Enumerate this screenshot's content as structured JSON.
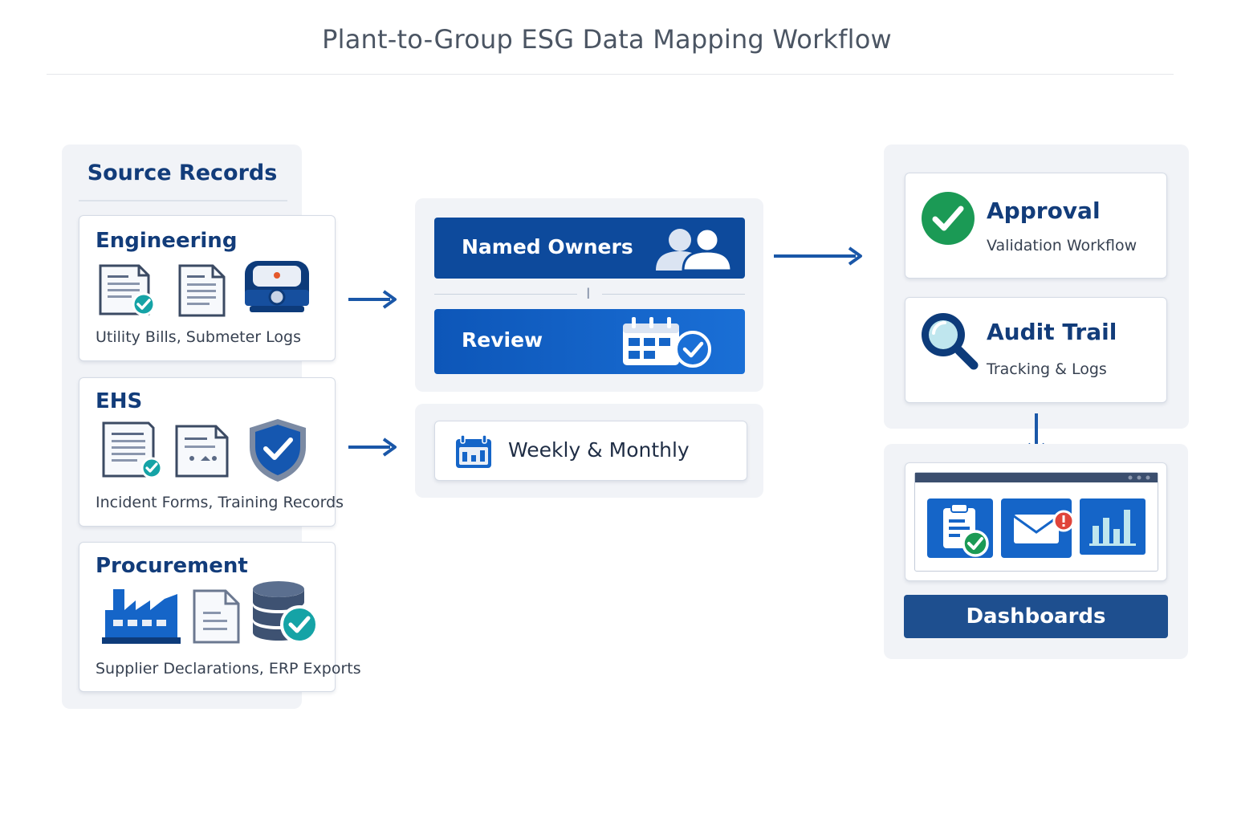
{
  "title": "Plant-to-Group ESG Data Mapping Workflow",
  "source_records": {
    "heading": "Source Records",
    "sections": [
      {
        "name": "Engineering",
        "description": "Utility Bills, Submeter Logs",
        "icons": [
          "bill-document-check-icon",
          "log-document-icon",
          "meter-device-icon"
        ]
      },
      {
        "name": "EHS",
        "description": "Incident Forms, Training Records",
        "icons": [
          "incident-form-check-icon",
          "training-record-icon",
          "shield-check-icon"
        ]
      },
      {
        "name": "Procurement",
        "description": "Supplier Declarations, ERP Exports",
        "icons": [
          "factory-icon",
          "declaration-document-icon",
          "database-check-icon"
        ]
      }
    ]
  },
  "process": {
    "named_owners": "Named Owners",
    "separator": "I",
    "review": "Review",
    "cadence": "Weekly & Monthly"
  },
  "outputs": {
    "approval": {
      "title": "Approval",
      "subtitle": "Validation Workflow",
      "icon": "check-circle-icon"
    },
    "audit": {
      "title": "Audit Trail",
      "subtitle": "Tracking & Logs",
      "icon": "magnifier-icon"
    },
    "dashboards": {
      "label": "Dashboards",
      "icons": [
        "clipboard-check-icon",
        "mail-alert-icon",
        "bar-chart-icon"
      ]
    }
  },
  "colors": {
    "accent_dark": "#0d4a9c",
    "accent": "#1565c8",
    "teal": "#15a3a6",
    "green": "#1b9a55",
    "heading": "#123c7a"
  }
}
